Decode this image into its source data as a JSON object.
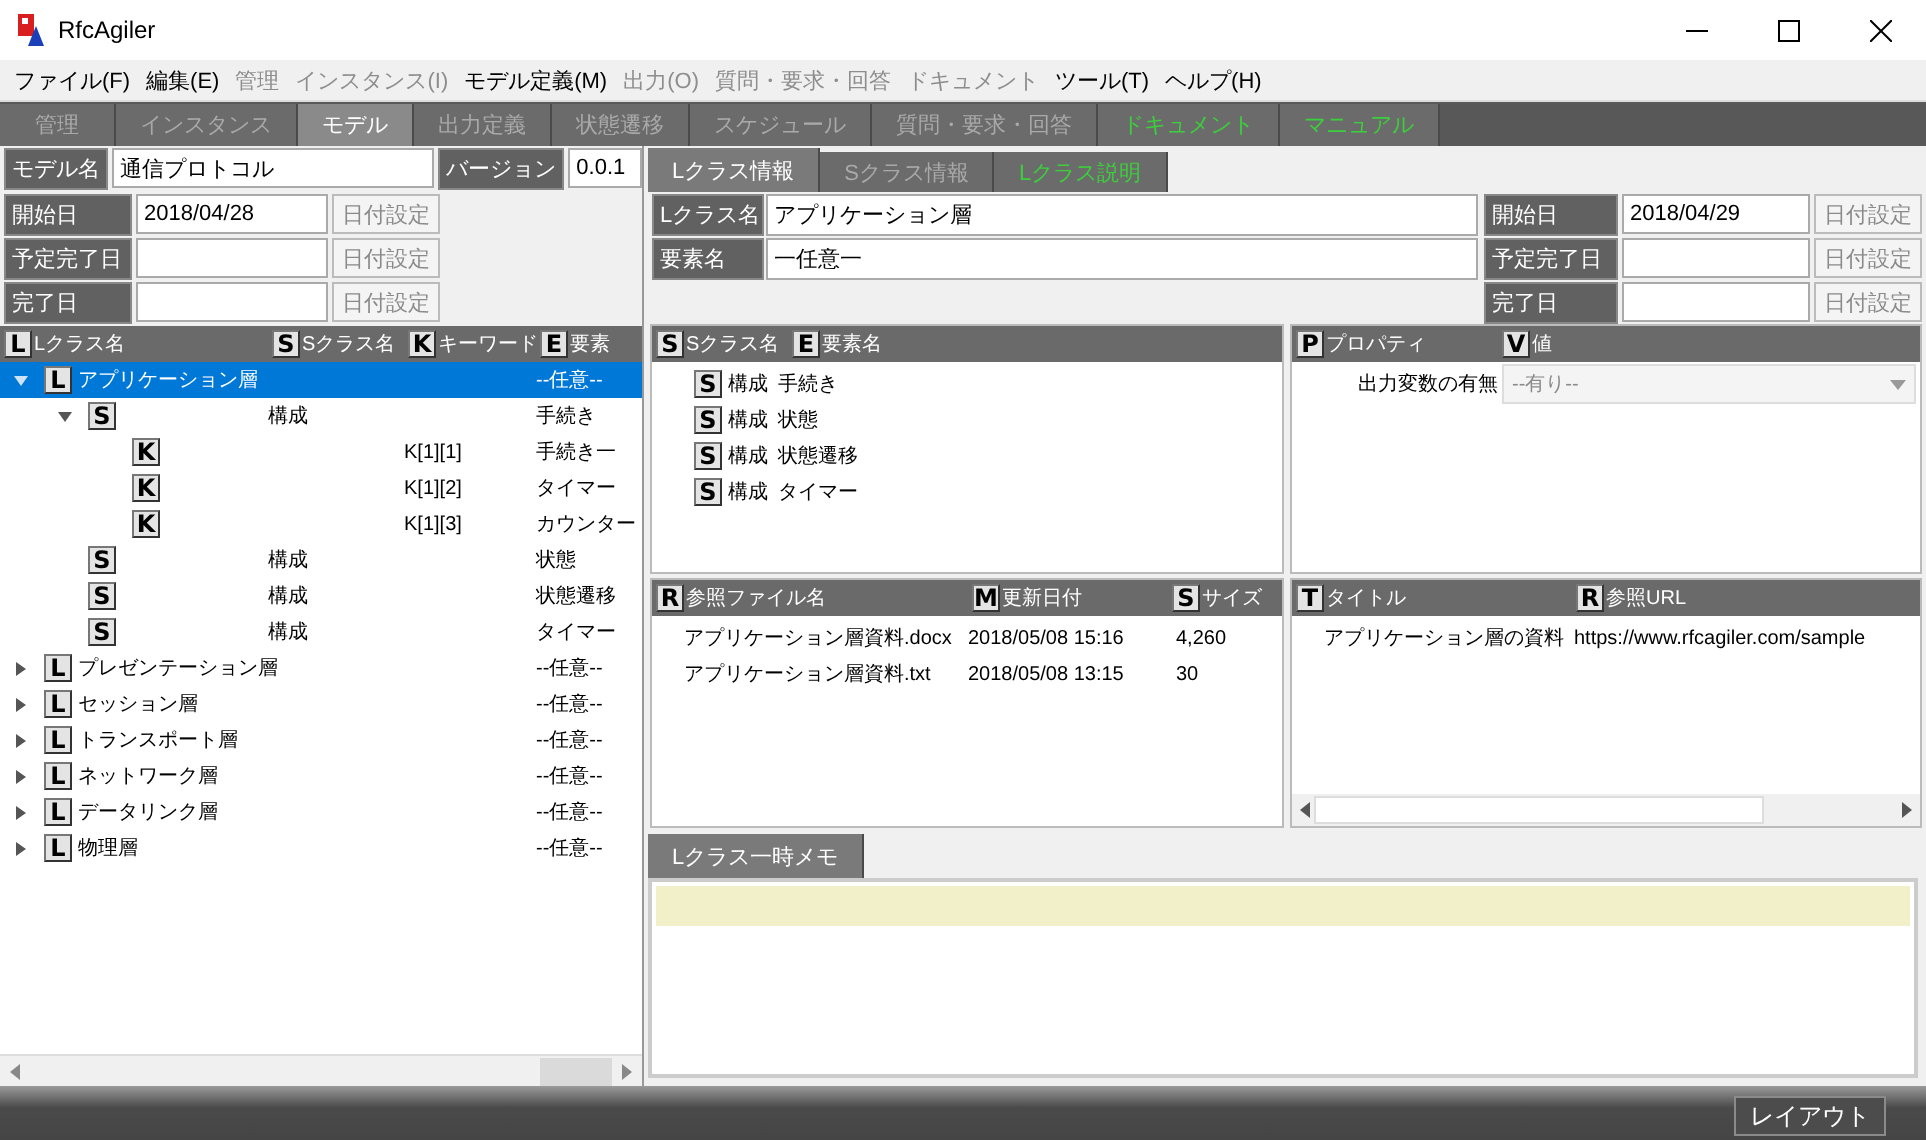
{
  "window": {
    "title": "RfcAgiler"
  },
  "menu": [
    {
      "label": "ファイル(F)",
      "disabled": false
    },
    {
      "label": "編集(E)",
      "disabled": false
    },
    {
      "label": "管理",
      "disabled": true
    },
    {
      "label": "インスタンス(I)",
      "disabled": true
    },
    {
      "label": "モデル定義(M)",
      "disabled": false
    },
    {
      "label": "出力(O)",
      "disabled": true
    },
    {
      "label": "質問・要求・回答",
      "disabled": true
    },
    {
      "label": "ドキュメント",
      "disabled": true
    },
    {
      "label": "ツール(T)",
      "disabled": false
    },
    {
      "label": "ヘルプ(H)",
      "disabled": false
    }
  ],
  "main_tabs": [
    {
      "label": "管理",
      "selected": false,
      "disabled": true,
      "highlighted": false
    },
    {
      "label": "インスタンス",
      "selected": false,
      "disabled": true,
      "highlighted": false
    },
    {
      "label": "モデル",
      "selected": true,
      "disabled": false,
      "highlighted": false
    },
    {
      "label": "出力定義",
      "selected": false,
      "disabled": true,
      "highlighted": false
    },
    {
      "label": "状態遷移",
      "selected": false,
      "disabled": true,
      "highlighted": false
    },
    {
      "label": "スケジュール",
      "selected": false,
      "disabled": true,
      "highlighted": false
    },
    {
      "label": "質問・要求・回答",
      "selected": false,
      "disabled": true,
      "highlighted": false
    },
    {
      "label": "ドキュメント",
      "selected": false,
      "disabled": false,
      "highlighted": true
    },
    {
      "label": "マニュアル",
      "selected": false,
      "disabled": false,
      "highlighted": true
    }
  ],
  "model": {
    "name_label": "モデル名",
    "name": "通信プロトコル",
    "version_label": "バージョン",
    "version": "0.0.1",
    "dates": [
      {
        "label": "開始日",
        "value": "2018/04/28",
        "button": "日付設定",
        "disabled": true
      },
      {
        "label": "予定完了日",
        "button": "日付設定",
        "disabled": true
      },
      {
        "label": "完了日",
        "button": "日付設定",
        "disabled": true
      }
    ]
  },
  "tree": {
    "columns": [
      {
        "badge": "L",
        "label": "Lクラス名"
      },
      {
        "badge": "S",
        "label": "Sクラス名"
      },
      {
        "badge": "K",
        "label": "キーワード"
      },
      {
        "badge": "E",
        "label": "要素"
      }
    ],
    "items": [
      {
        "badge": "L",
        "name": "アプリケーション層",
        "element": "--任意--",
        "expanded": true,
        "selected": true,
        "children": [
          {
            "badge": "S",
            "sclass": "構成",
            "element": "手続き",
            "expanded": true,
            "selected": false,
            "children": [
              {
                "badge": "K",
                "keyword": "K[1][1]",
                "element": "手続き一",
                "selected": false
              },
              {
                "badge": "K",
                "keyword": "K[1][2]",
                "element": "タイマー",
                "selected": false
              },
              {
                "badge": "K",
                "keyword": "K[1][3]",
                "element": "カウンター",
                "selected": false
              }
            ]
          },
          {
            "badge": "S",
            "sclass": "構成",
            "element": "状態",
            "selected": false
          },
          {
            "badge": "S",
            "sclass": "構成",
            "element": "状態遷移",
            "selected": false
          },
          {
            "badge": "S",
            "sclass": "構成",
            "element": "タイマー",
            "selected": false
          }
        ]
      },
      {
        "badge": "L",
        "name": "プレゼンテーション層",
        "element": "--任意--",
        "expanded": false,
        "selected": false
      },
      {
        "badge": "L",
        "name": "セッション層",
        "element": "--任意--",
        "expanded": false,
        "selected": false
      },
      {
        "badge": "L",
        "name": "トランスポート層",
        "element": "--任意--",
        "expanded": false,
        "selected": false
      },
      {
        "badge": "L",
        "name": "ネットワーク層",
        "element": "--任意--",
        "expanded": false,
        "selected": false
      },
      {
        "badge": "L",
        "name": "データリンク層",
        "element": "--任意--",
        "expanded": false,
        "selected": false
      },
      {
        "badge": "L",
        "name": "物理層",
        "element": "--任意--",
        "expanded": false,
        "selected": false
      }
    ]
  },
  "detail_tabs": [
    {
      "label": "Lクラス情報",
      "selected": true,
      "disabled": false,
      "highlighted": false
    },
    {
      "label": "Sクラス情報",
      "selected": false,
      "disabled": true,
      "highlighted": false
    },
    {
      "label": "Lクラス説明",
      "selected": false,
      "disabled": false,
      "highlighted": true
    }
  ],
  "lclass": {
    "fields": [
      {
        "label": "Lクラス名",
        "value": "アプリケーション層"
      },
      {
        "label": "要素名",
        "value": "一任意一"
      }
    ],
    "dates": [
      {
        "label": "開始日",
        "value": "2018/04/29",
        "button": "日付設定",
        "disabled": true
      },
      {
        "label": "予定完了日",
        "button": "日付設定",
        "disabled": true
      },
      {
        "label": "完了日",
        "button": "日付設定",
        "disabled": true
      }
    ]
  },
  "sclass_grid": {
    "columns": [
      {
        "badge": "S",
        "label": "Sクラス名"
      },
      {
        "badge": "E",
        "label": "要素名"
      }
    ],
    "rows": [
      {
        "badge": "S",
        "sclass": "構成",
        "element": "手続き"
      },
      {
        "badge": "S",
        "sclass": "構成",
        "element": "状態"
      },
      {
        "badge": "S",
        "sclass": "構成",
        "element": "状態遷移"
      },
      {
        "badge": "S",
        "sclass": "構成",
        "element": "タイマー"
      }
    ]
  },
  "property_grid": {
    "columns": [
      {
        "badge": "P",
        "label": "プロパティ"
      },
      {
        "badge": "V",
        "label": "値"
      }
    ],
    "rows": [
      {
        "property": "出力変数の有無",
        "value": "--有り--",
        "disabled": true
      }
    ]
  },
  "file_grid": {
    "columns": [
      {
        "badge": "R",
        "label": "参照ファイル名"
      },
      {
        "badge": "M",
        "label": "更新日付"
      },
      {
        "badge": "S",
        "label": "サイズ"
      }
    ],
    "rows": [
      {
        "file": "アプリケーション層資料.docx",
        "updated": "2018/05/08 15:16",
        "size": "4,260"
      },
      {
        "file": "アプリケーション層資料.txt",
        "updated": "2018/05/08 13:15",
        "size": "30"
      }
    ]
  },
  "link_grid": {
    "columns": [
      {
        "badge": "T",
        "label": "タイトル"
      },
      {
        "badge": "R",
        "label": "参照URL"
      }
    ],
    "rows": [
      {
        "title": "アプリケーション層の資料",
        "url": "https://www.rfcagiler.com/sample"
      }
    ]
  },
  "memo_tabs": [
    {
      "label": "Lクラス一時メモ",
      "selected": true,
      "disabled": false,
      "highlighted": false
    }
  ],
  "layout_button": "レイアウト"
}
